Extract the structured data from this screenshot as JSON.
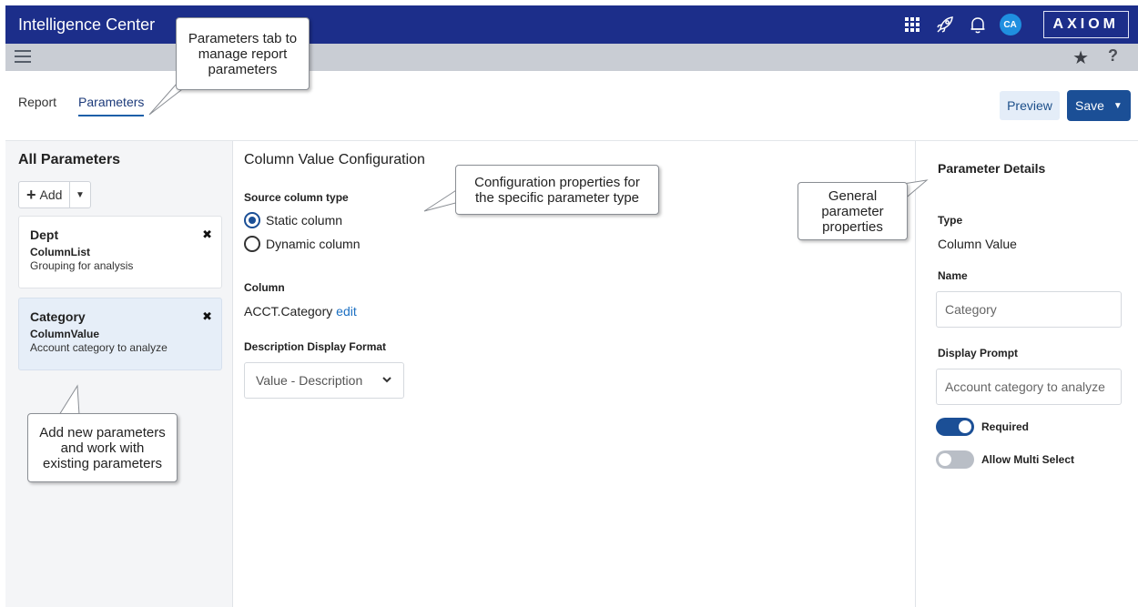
{
  "app": {
    "title": "Intelligence Center",
    "logo_text": "AXIOM",
    "user_initials": "CA"
  },
  "colors": {
    "topbar": "#1c2e8a",
    "accent": "#1b4f96",
    "avatar": "#1f8fe0"
  },
  "icons": [
    "apps-grid-icon",
    "rocket-icon",
    "bell-icon",
    "menu-icon",
    "star-icon",
    "help-icon",
    "close-icon",
    "chevron-down-icon"
  ],
  "subbar": {
    "help": "?"
  },
  "tabs": [
    {
      "label": "Report",
      "active": false
    },
    {
      "label": "Parameters",
      "active": true
    }
  ],
  "actions": {
    "preview": "Preview",
    "save": "Save"
  },
  "left": {
    "heading": "All Parameters",
    "add_label": "Add",
    "params": [
      {
        "name": "Dept",
        "type": "ColumnList",
        "description": "Grouping for analysis",
        "selected": false
      },
      {
        "name": "Category",
        "type": "ColumnValue",
        "description": "Account category to analyze",
        "selected": true
      }
    ]
  },
  "middle": {
    "heading": "Column Value Configuration",
    "source_label": "Source column type",
    "options": [
      {
        "label": "Static column",
        "checked": true
      },
      {
        "label": "Dynamic column",
        "checked": false
      }
    ],
    "column_label": "Column",
    "column_value": "ACCT.Category",
    "edit_link": "edit",
    "format_label": "Description Display Format",
    "format_value": "Value - Description"
  },
  "right": {
    "heading": "Parameter Details",
    "type_label": "Type",
    "type_value": "Column Value",
    "name_label": "Name",
    "name_value": "Category",
    "prompt_label": "Display Prompt",
    "prompt_value": "Account category to analyze",
    "required_label": "Required",
    "required_on": true,
    "multi_label": "Allow Multi Select",
    "multi_on": false
  },
  "callouts": {
    "tab": [
      "Parameters tab to",
      "manage report",
      "parameters"
    ],
    "config": [
      "Configuration properties for",
      "the specific parameter type"
    ],
    "general": [
      "General",
      "parameter",
      "properties"
    ],
    "params": [
      "Add new parameters",
      "and work with",
      "existing parameters"
    ]
  }
}
